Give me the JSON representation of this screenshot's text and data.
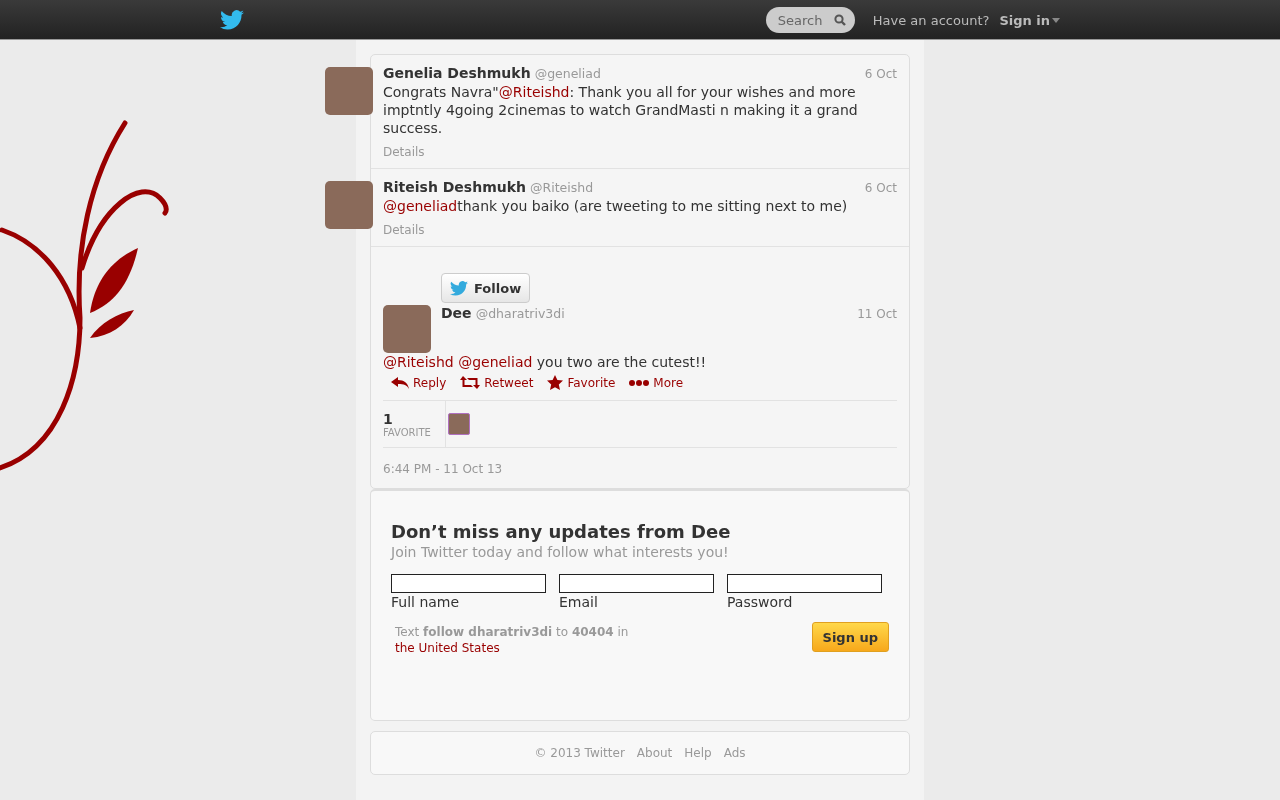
{
  "topbar": {
    "search": {
      "placeholder": "Search"
    },
    "account_prompt": "Have an account?",
    "sign_in": "Sign in"
  },
  "tweets": [
    {
      "name": "Genelia Deshmukh",
      "handle": "@geneliad",
      "date": "6 Oct",
      "segments": [
        {
          "kind": "text",
          "text": "Congrats Navra\""
        },
        {
          "kind": "mention",
          "text": "@Riteishd"
        },
        {
          "kind": "text",
          "text": ": Thank you all for your wishes and more imptntly 4going 2cinemas to watch GrandMasti n making it a grand success."
        }
      ],
      "details": "Details"
    },
    {
      "name": "Riteish Deshmukh",
      "handle": "@Riteishd",
      "date": "6 Oct",
      "segments": [
        {
          "kind": "mention",
          "text": "@geneliad"
        },
        {
          "kind": "text",
          "text": "thank you baiko (are tweeting to me sitting next to me)"
        }
      ],
      "details": "Details"
    }
  ],
  "focus_tweet": {
    "follow": "Follow",
    "name": "Dee",
    "handle": "@dharatriv3di",
    "date": "11 Oct",
    "segments": [
      {
        "kind": "mention",
        "text": "@Riteishd"
      },
      {
        "kind": "mention",
        "text": "@geneliad"
      },
      {
        "kind": "text",
        "text": "you two are the cutest!!"
      }
    ],
    "actions": [
      {
        "kind": "reply",
        "label": "Reply"
      },
      {
        "kind": "retweet",
        "label": "Retweet"
      },
      {
        "kind": "favorite",
        "label": "Favorite"
      },
      {
        "kind": "more",
        "label": "More"
      }
    ],
    "stats": {
      "count": "1",
      "label": "FAVORITE"
    },
    "timestamp": "6:44 PM - 11 Oct 13"
  },
  "signup": {
    "title": "Don’t miss any updates from Dee",
    "subtitle": "Join Twitter today and follow what interests you!",
    "fields": [
      {
        "label": "Full name"
      },
      {
        "label": "Email"
      },
      {
        "label": "Password"
      }
    ],
    "sms": "Text **follow dharatriv3di**  to **40404** in",
    "sms_link": "the United States",
    "button": "Sign up"
  },
  "footer": [
    "© 2013 Twitter",
    "About",
    "Help",
    "Ads"
  ]
}
